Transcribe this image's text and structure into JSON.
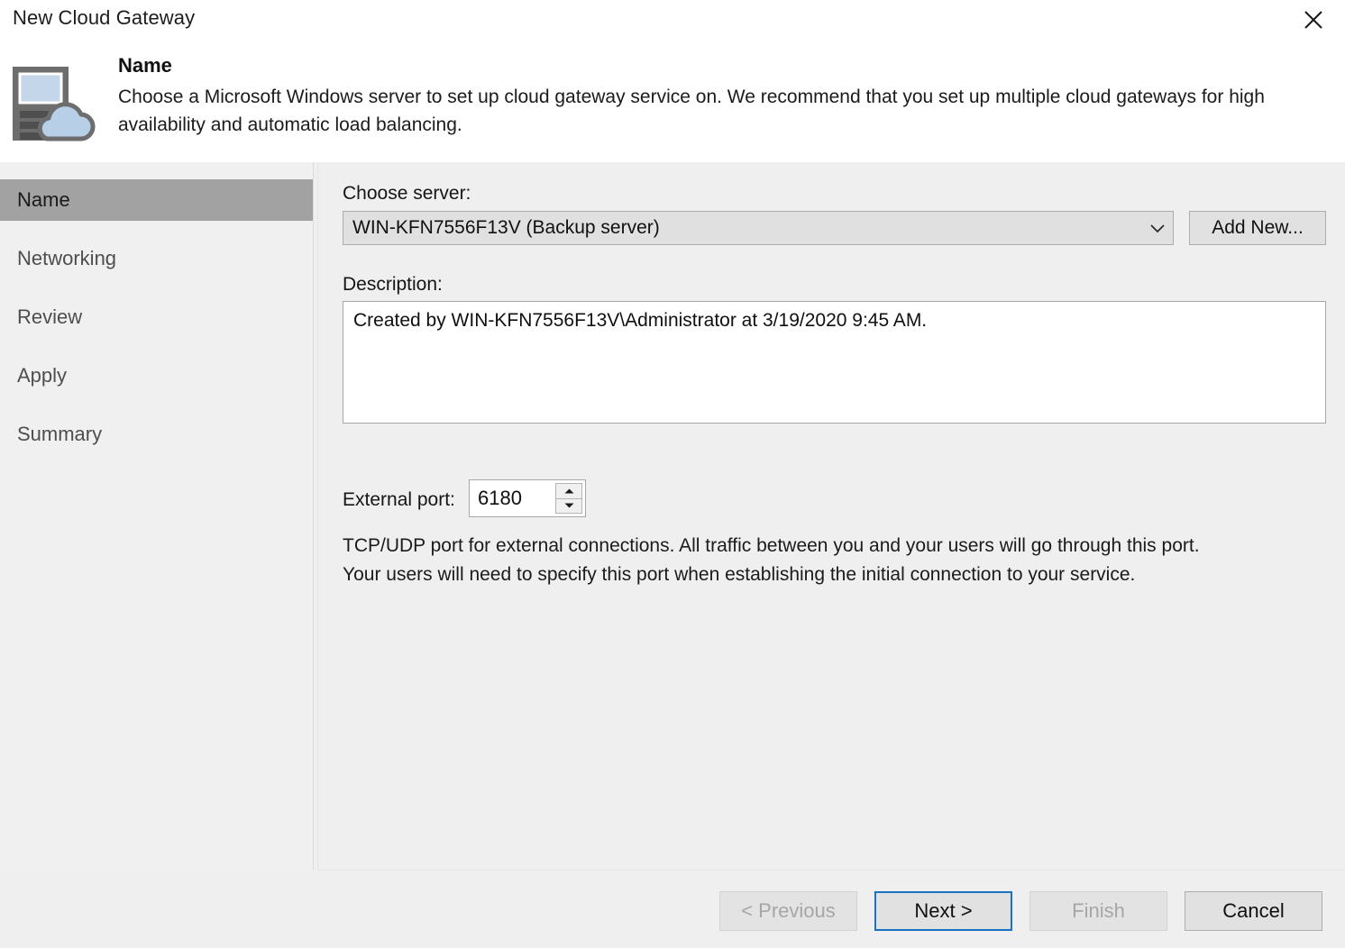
{
  "window": {
    "title": "New Cloud Gateway",
    "close_icon": "close-icon"
  },
  "header": {
    "icon": "server-cloud-icon",
    "title": "Name",
    "description": "Choose a Microsoft Windows server to set up cloud gateway service on. We recommend that you set up multiple cloud gateways for high availability and automatic load balancing."
  },
  "sidebar": {
    "items": [
      {
        "label": "Name",
        "selected": true
      },
      {
        "label": "Networking",
        "selected": false
      },
      {
        "label": "Review",
        "selected": false
      },
      {
        "label": "Apply",
        "selected": false
      },
      {
        "label": "Summary",
        "selected": false
      }
    ]
  },
  "form": {
    "choose_server_label": "Choose server:",
    "choose_server_value": "WIN-KFN7556F13V (Backup server)",
    "choose_server_arrow_icon": "chevron-down-icon",
    "add_new_label": "Add New...",
    "description_label": "Description:",
    "description_value": "Created by WIN-KFN7556F13V\\Administrator at 3/19/2020 9:45 AM.",
    "external_port_label": "External port:",
    "external_port_value": "6180",
    "spinner_up_icon": "triangle-up-icon",
    "spinner_down_icon": "triangle-down-icon",
    "port_help_line1": "TCP/UDP port for external connections. All traffic between you and your users will go through this port.",
    "port_help_line2": "Your users will need to specify this port when establishing the initial connection to your service."
  },
  "footer": {
    "previous_label": "< Previous",
    "next_label": "Next >",
    "finish_label": "Finish",
    "cancel_label": "Cancel"
  },
  "colors": {
    "accent": "#1a72c6",
    "selection": "#a2a2a2",
    "panel_bg": "#efefef",
    "icon_cloud": "#b8cfe8",
    "icon_server": "#686868"
  }
}
